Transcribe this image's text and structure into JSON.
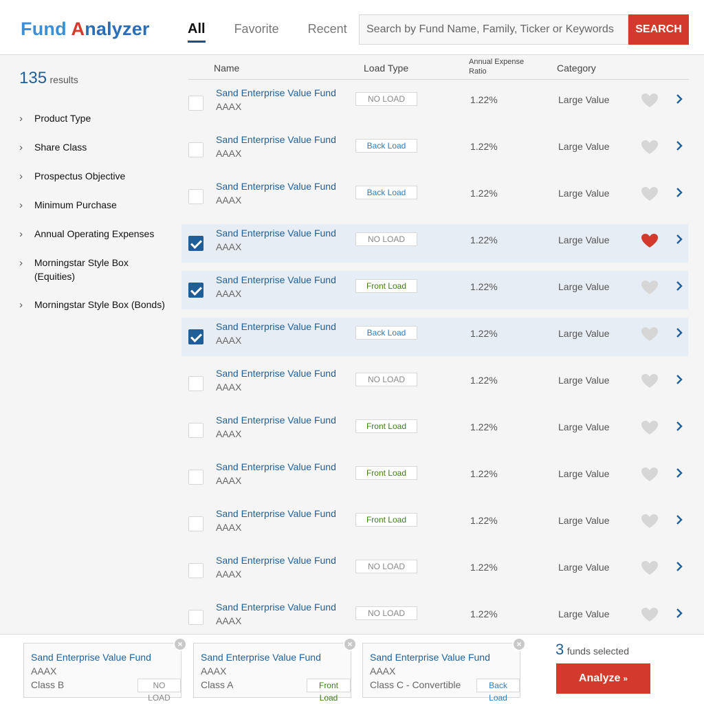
{
  "header": {
    "logo_fund": "Fund",
    "logo_a": "A",
    "logo_rest": "nalyzer",
    "tabs": [
      {
        "label": "All",
        "active": true
      },
      {
        "label": "Favorite",
        "active": false
      },
      {
        "label": "Recent",
        "active": false
      }
    ],
    "search_placeholder": "Search by Fund Name, Family, Ticker or Keywords",
    "search_button": "SEARCH"
  },
  "sidebar": {
    "result_count": "135",
    "result_label": "results",
    "filters": [
      "Product Type",
      "Share Class",
      "Prospectus Objective",
      "Minimum Purchase",
      "Annual Operating Expenses",
      "Morningstar Style Box (Equities)",
      "Morningstar Style Box (Bonds)"
    ]
  },
  "table": {
    "headers": {
      "name": "Name",
      "load": "Load Type",
      "expense": "Annual Expense Ratio",
      "category": "Category"
    },
    "rows": [
      {
        "name": "Sand Enterprise Value Fund",
        "ticker": "AAAX",
        "load": "NO LOAD",
        "load_type": "no-load",
        "expense": "1.22%",
        "category": "Large Value",
        "checked": false,
        "favorite": false
      },
      {
        "name": "Sand Enterprise Value Fund",
        "ticker": "AAAX",
        "load": "Back Load",
        "load_type": "back-load",
        "expense": "1.22%",
        "category": "Large Value",
        "checked": false,
        "favorite": false
      },
      {
        "name": "Sand Enterprise Value Fund",
        "ticker": "AAAX",
        "load": "Back Load",
        "load_type": "back-load",
        "expense": "1.22%",
        "category": "Large Value",
        "checked": false,
        "favorite": false
      },
      {
        "name": "Sand Enterprise Value Fund",
        "ticker": "AAAX",
        "load": "NO LOAD",
        "load_type": "no-load",
        "expense": "1.22%",
        "category": "Large Value",
        "checked": true,
        "favorite": true
      },
      {
        "name": "Sand Enterprise Value Fund",
        "ticker": "AAAX",
        "load": "Front Load",
        "load_type": "front-load",
        "expense": "1.22%",
        "category": "Large Value",
        "checked": true,
        "favorite": false
      },
      {
        "name": "Sand Enterprise Value Fund",
        "ticker": "AAAX",
        "load": "Back Load",
        "load_type": "back-load",
        "expense": "1.22%",
        "category": "Large Value",
        "checked": true,
        "favorite": false
      },
      {
        "name": "Sand Enterprise Value Fund",
        "ticker": "AAAX",
        "load": "NO LOAD",
        "load_type": "no-load",
        "expense": "1.22%",
        "category": "Large Value",
        "checked": false,
        "favorite": false
      },
      {
        "name": "Sand Enterprise Value Fund",
        "ticker": "AAAX",
        "load": "Front Load",
        "load_type": "front-load",
        "expense": "1.22%",
        "category": "Large Value",
        "checked": false,
        "favorite": false
      },
      {
        "name": "Sand Enterprise Value Fund",
        "ticker": "AAAX",
        "load": "Front Load",
        "load_type": "front-load",
        "expense": "1.22%",
        "category": "Large Value",
        "checked": false,
        "favorite": false
      },
      {
        "name": "Sand Enterprise Value Fund",
        "ticker": "AAAX",
        "load": "Front Load",
        "load_type": "front-load",
        "expense": "1.22%",
        "category": "Large Value",
        "checked": false,
        "favorite": false
      },
      {
        "name": "Sand Enterprise Value Fund",
        "ticker": "AAAX",
        "load": "NO LOAD",
        "load_type": "no-load",
        "expense": "1.22%",
        "category": "Large Value",
        "checked": false,
        "favorite": false
      },
      {
        "name": "Sand Enterprise Value Fund",
        "ticker": "AAAX",
        "load": "NO LOAD",
        "load_type": "no-load",
        "expense": "1.22%",
        "category": "Large Value",
        "checked": false,
        "favorite": false
      }
    ]
  },
  "selected": {
    "cards": [
      {
        "name": "Sand Enterprise Value Fund",
        "ticker": "AAAX",
        "class": "Class B",
        "load": "NO LOAD",
        "load_type": "no-load"
      },
      {
        "name": "Sand Enterprise Value Fund",
        "ticker": "AAAX",
        "class": "Class A",
        "load": "Front Load",
        "load_type": "front-load"
      },
      {
        "name": "Sand Enterprise Value Fund",
        "ticker": "AAAX",
        "class": "Class C - Convertible",
        "load": "Back Load",
        "load_type": "back-load"
      }
    ],
    "count": "3",
    "count_label": "funds selected",
    "analyze_label": "Analyze"
  },
  "colors": {
    "brand_blue": "#1f5f99",
    "brand_red": "#d33a2c",
    "heart_off": "#d6d6d6",
    "heart_on": "#d33a2c"
  },
  "icons": {
    "heart": "heart-icon",
    "chevron_right": "chevron-right-icon",
    "close": "close-icon",
    "double_chevron_down": "double-chevron-down-icon"
  }
}
